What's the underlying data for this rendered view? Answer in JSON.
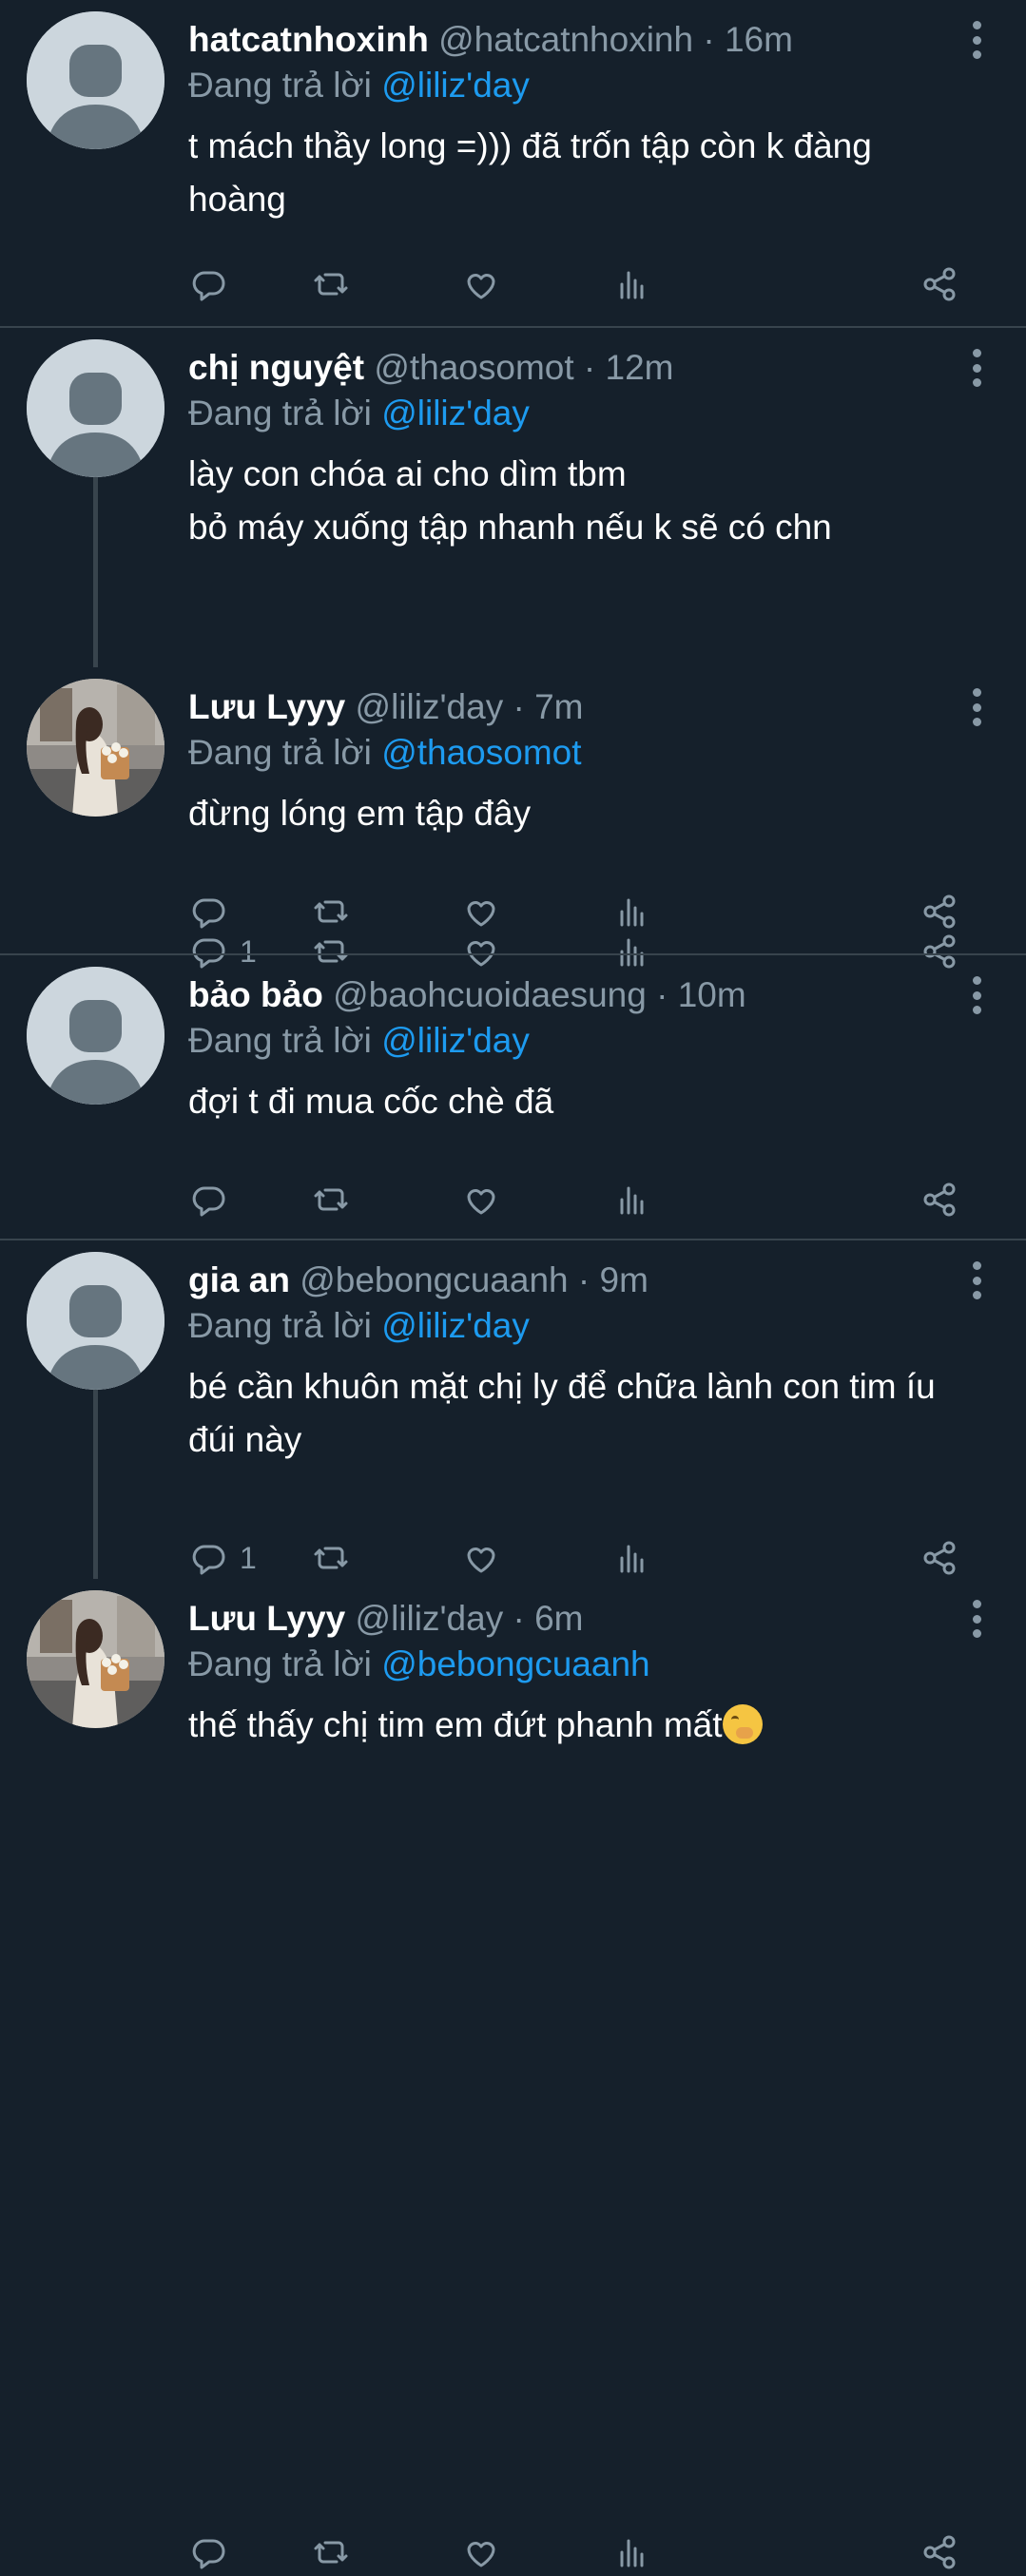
{
  "reply_prefix": "Đang trả lời",
  "tweets": [
    {
      "name": "hatcatnhoxinh",
      "meta": "@hatcatnhoxinh · 16m",
      "reply_to": "@liliz'day",
      "text": "t mách thầy long =))) đã trốn tập còn k đàng\nhoàng",
      "reply_count": "",
      "avatar": "default-avatar"
    },
    {
      "name": "chị nguyệt",
      "meta": "@thaosomot · 12m",
      "reply_to": "@liliz'day",
      "text": "lày con chóa ai cho dìm tbm\nbỏ máy xuống tập nhanh nếu k sẽ có chn",
      "reply_count": "1",
      "avatar": "default-avatar"
    },
    {
      "name": "Lưu Lyyy",
      "meta": "@liliz'day · 7m",
      "reply_to": "@thaosomot",
      "text": "đừng lóng em tập đây",
      "reply_count": "",
      "avatar": "photo-avatar"
    },
    {
      "name": "bảo bảo",
      "meta": "@baohcuoidaesung · 10m",
      "reply_to": "@liliz'day",
      "text": "đợi t đi mua cốc chè đã",
      "reply_count": "",
      "avatar": "default-avatar"
    },
    {
      "name": "gia an",
      "meta": "@bebongcuaanh · 9m",
      "reply_to": "@liliz'day",
      "text": "bé cần khuôn mặt chị ly để chữa lành con tim íu\nđúi này",
      "reply_count": "1",
      "avatar": "default-avatar"
    },
    {
      "name": "Lưu Lyyy",
      "meta": "@liliz'day · 6m",
      "reply_to": "@bebongcuaanh",
      "text": "thế thấy chị tim em đứt phanh mất",
      "reply_count": "",
      "avatar": "photo-avatar",
      "emoji": "face-with-hand-over-mouth"
    }
  ],
  "colors": {
    "background": "#15202b",
    "secondary_text": "#8899a6",
    "link": "#1d9bf0",
    "divider": "#38444d"
  }
}
